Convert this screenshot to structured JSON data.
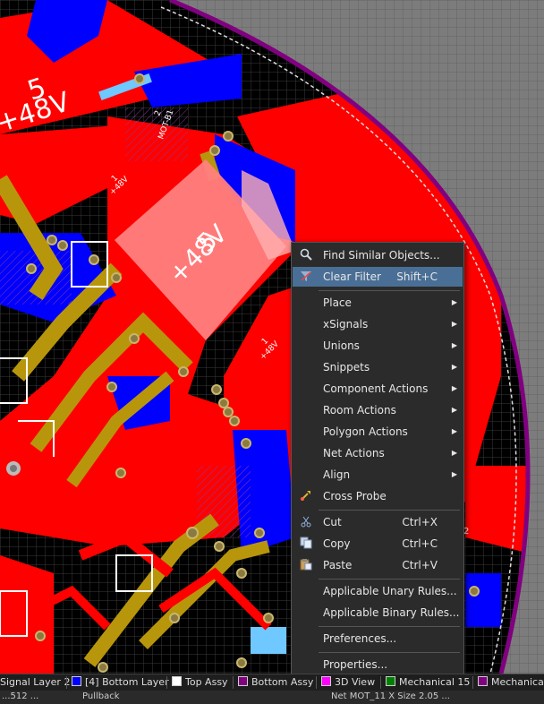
{
  "board": {
    "net_label_large_1": "5",
    "net_label_large_2": "+48V",
    "component_pad_label_1": "1",
    "component_pad_label_2": "+48V",
    "mot_label": "MOT-B1",
    "mot_pin": "2",
    "edge_label": "2"
  },
  "context_menu": {
    "items": [
      {
        "label": "Find Similar Objects...",
        "shortcut": "",
        "submenu": false,
        "icon": "magnifier-icon"
      },
      {
        "label": "Clear Filter",
        "shortcut": "Shift+C",
        "submenu": false,
        "icon": "clear-filter-icon",
        "highlighted": true
      },
      {
        "label": "Place",
        "shortcut": "",
        "submenu": true
      },
      {
        "label": "xSignals",
        "shortcut": "",
        "submenu": true
      },
      {
        "label": "Unions",
        "shortcut": "",
        "submenu": true
      },
      {
        "label": "Snippets",
        "shortcut": "",
        "submenu": true
      },
      {
        "label": "Component Actions",
        "shortcut": "",
        "submenu": true
      },
      {
        "label": "Room Actions",
        "shortcut": "",
        "submenu": true
      },
      {
        "label": "Polygon Actions",
        "shortcut": "",
        "submenu": true
      },
      {
        "label": "Net Actions",
        "shortcut": "",
        "submenu": true
      },
      {
        "label": "Align",
        "shortcut": "",
        "submenu": true
      },
      {
        "label": "Cross Probe",
        "shortcut": "",
        "submenu": false,
        "icon": "cross-probe-icon"
      },
      {
        "label": "Cut",
        "shortcut": "Ctrl+X",
        "submenu": false,
        "icon": "scissors-icon"
      },
      {
        "label": "Copy",
        "shortcut": "Ctrl+C",
        "submenu": false,
        "icon": "copy-icon"
      },
      {
        "label": "Paste",
        "shortcut": "Ctrl+V",
        "submenu": false,
        "icon": "paste-icon"
      },
      {
        "label": "Applicable Unary Rules...",
        "shortcut": "",
        "submenu": false
      },
      {
        "label": "Applicable Binary Rules...",
        "shortcut": "",
        "submenu": false
      },
      {
        "label": "Preferences...",
        "shortcut": "",
        "submenu": false
      },
      {
        "label": "Properties...",
        "shortcut": "",
        "submenu": false
      }
    ]
  },
  "layer_tabs": [
    {
      "label": "Signal Layer 2",
      "color": ""
    },
    {
      "label": "[4] Bottom Layer",
      "color": "#0000ff"
    },
    {
      "label": "Top Assy",
      "color": "#ffffff"
    },
    {
      "label": "Bottom Assy",
      "color": "#800080"
    },
    {
      "label": "3D View",
      "color": "#ff00ff"
    },
    {
      "label": "Mechanical 15",
      "color": "#008000"
    },
    {
      "label": "Mechanica",
      "color": "#800080"
    }
  ],
  "status": {
    "left": "...512 ...",
    "mode": "Pullback",
    "right": "Net MOT_11 X Size 2.05 ..."
  },
  "colors": {
    "top_copper": "#ff0000",
    "bottom_copper": "#0000ff",
    "top_overlay": "#b8960c",
    "board_outline": "#800080",
    "menu_highlight": "#4a6f96"
  }
}
